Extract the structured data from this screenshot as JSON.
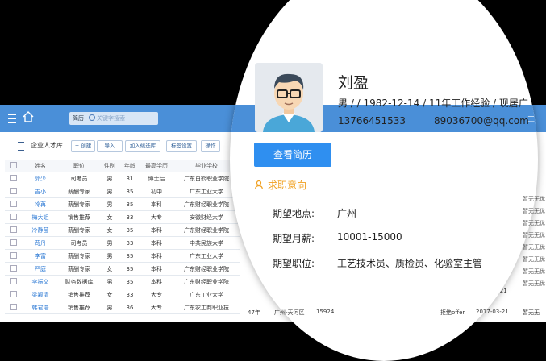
{
  "topbar": {
    "search_category": "简历",
    "search_placeholder": "关键字搜索",
    "right_text": "工"
  },
  "toolbar": {
    "title": "企业人才库",
    "buttons": [
      "+ 创建",
      "导入",
      "加入候选库",
      "标签设置",
      "操作"
    ]
  },
  "table": {
    "headers": [
      "姓名",
      "职位",
      "性别",
      "年龄",
      "最高学历",
      "毕业学校"
    ],
    "rows": [
      [
        "郭少",
        "司考员",
        "男",
        "31",
        "博士后",
        "广东白鹤职业学院"
      ],
      [
        "吉小",
        "薪酬专家",
        "男",
        "35",
        "初中",
        "广东工业大学"
      ],
      [
        "冷苒",
        "薪酬专家",
        "男",
        "35",
        "本科",
        "广东财经职业学院"
      ],
      [
        "梅大姐",
        "销售推荐",
        "女",
        "33",
        "大专",
        "安徽财经大学"
      ],
      [
        "冷静莹",
        "薪酬专家",
        "女",
        "35",
        "本科",
        "广东财经职业学院"
      ],
      [
        "苟丹",
        "司考员",
        "男",
        "33",
        "本科",
        "中共民族大学"
      ],
      [
        "李富",
        "薪酬专家",
        "男",
        "35",
        "本科",
        "广东工业大学"
      ],
      [
        "严庭",
        "薪酬专家",
        "女",
        "35",
        "本科",
        "广东财经职业学院"
      ],
      [
        "李振文",
        "财务数据库",
        "男",
        "35",
        "本科",
        "广东财经职业学院"
      ],
      [
        "梁颖清",
        "销售推荐",
        "女",
        "33",
        "大专",
        "广东工业大学"
      ],
      [
        "韩君浩",
        "销售推荐",
        "男",
        "36",
        "大专",
        "广东农工商职业技"
      ]
    ],
    "extra_row": {
      "years": "47年",
      "location": "广州-天河区",
      "phone": "15924",
      "status": "拒绝offer",
      "date": "2017-03-21",
      "tag": "暂无无"
    }
  },
  "right_column": {
    "dates": [
      "2017-03-21",
      "2017-03-21"
    ],
    "tags": [
      "暂无无优",
      "暂无无优",
      "暂无无优",
      "暂无无优",
      "暂无无优",
      "暂无无优",
      "暂无无优",
      "暂无无优"
    ]
  },
  "profile": {
    "name": "刘盈",
    "info": "男 / / 1982-12-14 / 11年工作经验 / 现居广",
    "phone": "13766451533",
    "email": "89036700@qq.com",
    "resume_button": "查看简历",
    "intent_title": "求职意向",
    "location_label": "期望地点:",
    "location_value": "广州",
    "salary_label": "期望月薪:",
    "salary_value": "10001-15000",
    "position_label": "期望职位:",
    "position_value": "工艺技术员、质检员、化验室主管"
  }
}
